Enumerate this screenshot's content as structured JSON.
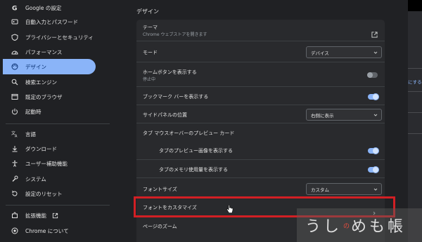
{
  "sidebar": {
    "items": [
      {
        "label": "Google の設定",
        "icon": "google-icon"
      },
      {
        "label": "自動入力とパスワード",
        "icon": "autofill-icon"
      },
      {
        "label": "プライバシーとセキュリティ",
        "icon": "shield-icon"
      },
      {
        "label": "パフォーマンス",
        "icon": "speedometer-icon"
      },
      {
        "label": "デザイン",
        "icon": "palette-icon",
        "active": true
      },
      {
        "label": "検索エンジン",
        "icon": "search-icon"
      },
      {
        "label": "既定のブラウザ",
        "icon": "browser-icon"
      },
      {
        "label": "起動時",
        "icon": "power-icon"
      },
      {
        "label": "言語",
        "icon": "translate-icon"
      },
      {
        "label": "ダウンロード",
        "icon": "download-icon"
      },
      {
        "label": "ユーザー補助機能",
        "icon": "accessibility-icon"
      },
      {
        "label": "システム",
        "icon": "wrench-icon"
      },
      {
        "label": "設定のリセット",
        "icon": "reset-icon"
      },
      {
        "label": "拡張機能",
        "icon": "puzzle-icon"
      },
      {
        "label": "Chrome について",
        "icon": "chrome-icon"
      }
    ]
  },
  "main": {
    "section_title": "デザイン",
    "theme": {
      "label": "テーマ",
      "sub": "Chrome ウェブストアを開きます"
    },
    "mode": {
      "label": "モード",
      "value": "デバイス"
    },
    "home_button": {
      "label": "ホームボタンを表示する",
      "sub": "停止中",
      "enabled": false
    },
    "bookmark_bar": {
      "label": "ブックマーク バーを表示する",
      "enabled": true
    },
    "side_panel": {
      "label": "サイドパネルの位置",
      "value": "右側に表示"
    },
    "tab_hover": {
      "label": "タブ マウスオーバーのプレビュー カード"
    },
    "tab_preview_image": {
      "label": "タブのプレビュー画像を表示する",
      "enabled": true
    },
    "tab_memory": {
      "label": "タブのメモリ使用量を表示する",
      "enabled": true
    },
    "font_size": {
      "label": "フォントサイズ",
      "value": "カスタム"
    },
    "customize_fonts": {
      "label": "フォントをカスタマイズ"
    },
    "page_zoom": {
      "label": "ページのズーム"
    }
  },
  "right_panel": {
    "text": "にする"
  },
  "watermark": {
    "text_a": "うし",
    "text_small": "の",
    "text_b": "めも帳"
  },
  "colors": {
    "accent": "#8ab4f8",
    "highlight": "#d21f24",
    "background": "#202124",
    "card": "#292a2d"
  }
}
